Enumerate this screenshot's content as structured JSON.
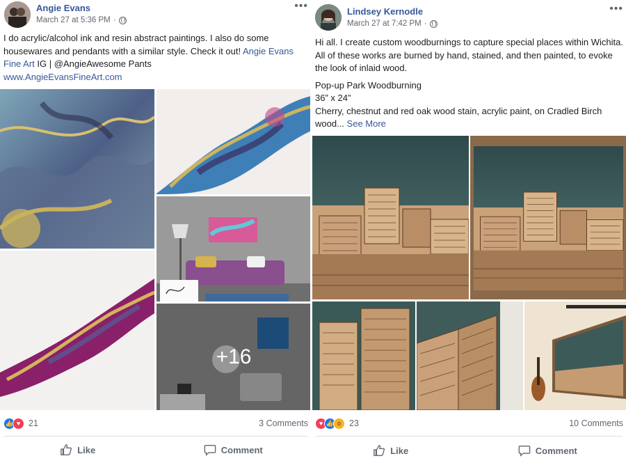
{
  "posts": [
    {
      "author": "Angie Evans",
      "timestamp": "March 27 at 5:36 PM",
      "dot": "·",
      "more": "•••",
      "text_plain": "I do acrylic/alcohol ink and resin abstract paintings. I also do some housewares and pendants with a similar style. Check it out!",
      "text_link": "Angie Evans Fine Art",
      "text_after_link": "IG | @AngieAwesome Pants",
      "website": "www.AngieEvansFineArt.com",
      "more_photos": "+16",
      "reaction_count": "21",
      "comments": "3 Comments",
      "like_label": "Like",
      "comment_label": "Comment"
    },
    {
      "author": "Lindsey Kernodle",
      "timestamp": "March 27 at 7:42 PM",
      "dot": "·",
      "more": "•••",
      "text_intro": "Hi all. I create custom woodburnings to capture special places within Wichita. All of these works are burned by hand, stained, and then painted, to evoke the look of inlaid wood.",
      "text_title": "Pop-up Park Woodburning",
      "text_size": "36” x 24”",
      "text_materials": "Cherry, chestnut and red oak wood stain, acrylic paint, on Cradled Birch wood...",
      "see_more": "See More",
      "reaction_count": "23",
      "comments": "10 Comments",
      "like_label": "Like",
      "comment_label": "Comment"
    }
  ],
  "colors": {
    "link": "#385898",
    "like": "#1877f2",
    "love": "#f33e58",
    "wow": "#f7b125",
    "meta": "#606770"
  },
  "icons": {
    "globe": "globe-icon",
    "like": "thumbs-up-icon",
    "comment": "speech-bubble-icon"
  }
}
